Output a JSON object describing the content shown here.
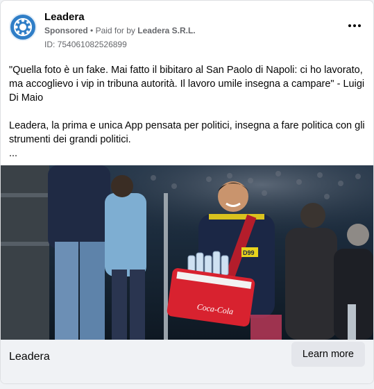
{
  "ad": {
    "page_name": "Leadera",
    "sponsored": "Sponsored",
    "separator": "•",
    "paid_prefix": "Paid for by",
    "payer": "Leadera S.R.L.",
    "ad_id": "ID: 754061082526899",
    "menu_icon": "more-horizontal-icon",
    "body": {
      "paragraph1": "\"Quella foto è un fake. Mai fatto il bibitaro al San Paolo di Napoli: ci ho lavorato, ma accoglievo i vip in tribuna autorità. Il lavoro umile insegna a campare\" - Luigi Di Maio",
      "paragraph2": "Leadera, la prima e unica App pensata per politici, insegna a fare politica con gli strumenti dei grandi politici.",
      "ellipsis": "..."
    },
    "image": {
      "badge_text": "D99",
      "cooler_text": "Coca-Cola"
    },
    "footer": {
      "title": "Leadera",
      "cta_label": "Learn more"
    }
  },
  "colors": {
    "brand": "#2f7ec7",
    "muted_text": "#65676b",
    "cta_bg": "#e4e6eb",
    "footer_bg": "#f0f2f5"
  }
}
